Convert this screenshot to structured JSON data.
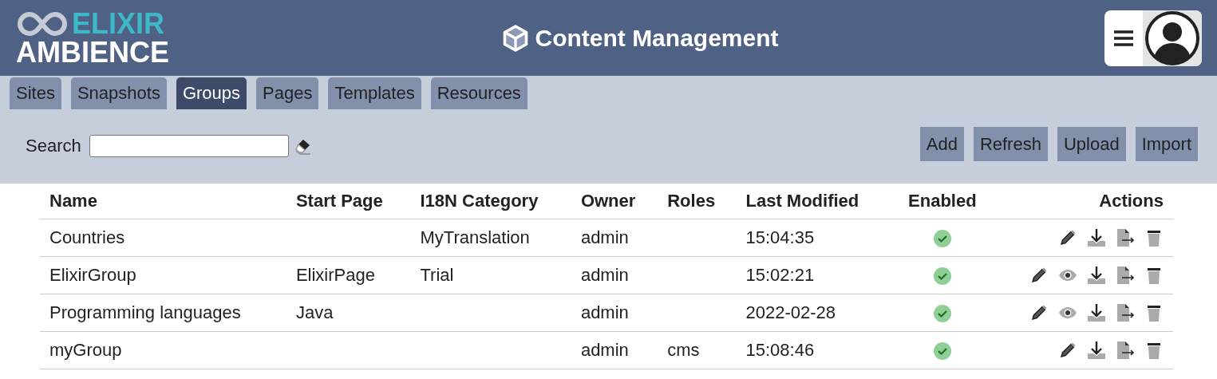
{
  "header": {
    "logo_top": "ELIXIR",
    "logo_bottom": "AMBIENCE",
    "title": "Content Management"
  },
  "tabs": [
    {
      "label": "Sites",
      "selected": false
    },
    {
      "label": "Snapshots",
      "selected": false
    },
    {
      "label": "Groups",
      "selected": true
    },
    {
      "label": "Pages",
      "selected": false
    },
    {
      "label": "Templates",
      "selected": false
    },
    {
      "label": "Resources",
      "selected": false
    }
  ],
  "search": {
    "label": "Search"
  },
  "buttons": [
    "Add",
    "Refresh",
    "Upload",
    "Import"
  ],
  "table": {
    "columns": [
      "Name",
      "Start Page",
      "I18N Category",
      "Owner",
      "Roles",
      "Last Modified",
      "Enabled",
      "Actions"
    ],
    "rows": [
      {
        "name": "Countries",
        "start_page": "",
        "category": "MyTranslation",
        "owner": "admin",
        "roles": "",
        "modified": "15:04:35",
        "enabled": true,
        "actions": [
          {
            "kind": "edit"
          },
          {
            "kind": "download"
          },
          {
            "kind": "export"
          },
          {
            "kind": "delete"
          }
        ]
      },
      {
        "name": "ElixirGroup",
        "start_page": "ElixirPage",
        "category": "Trial",
        "owner": "admin",
        "roles": "",
        "modified": "15:02:21",
        "enabled": true,
        "actions": [
          {
            "kind": "edit"
          },
          {
            "kind": "view"
          },
          {
            "kind": "download"
          },
          {
            "kind": "export"
          },
          {
            "kind": "delete"
          }
        ]
      },
      {
        "name": "Programming languages",
        "start_page": "Java",
        "category": "",
        "owner": "admin",
        "roles": "",
        "modified": "2022-02-28",
        "enabled": true,
        "actions": [
          {
            "kind": "edit"
          },
          {
            "kind": "view"
          },
          {
            "kind": "download"
          },
          {
            "kind": "export"
          },
          {
            "kind": "delete"
          }
        ]
      },
      {
        "name": "myGroup",
        "start_page": "",
        "category": "",
        "owner": "admin",
        "roles": "cms",
        "modified": "15:08:46",
        "enabled": true,
        "actions": [
          {
            "kind": "edit"
          },
          {
            "kind": "download"
          },
          {
            "kind": "export"
          },
          {
            "kind": "delete"
          }
        ]
      }
    ]
  }
}
